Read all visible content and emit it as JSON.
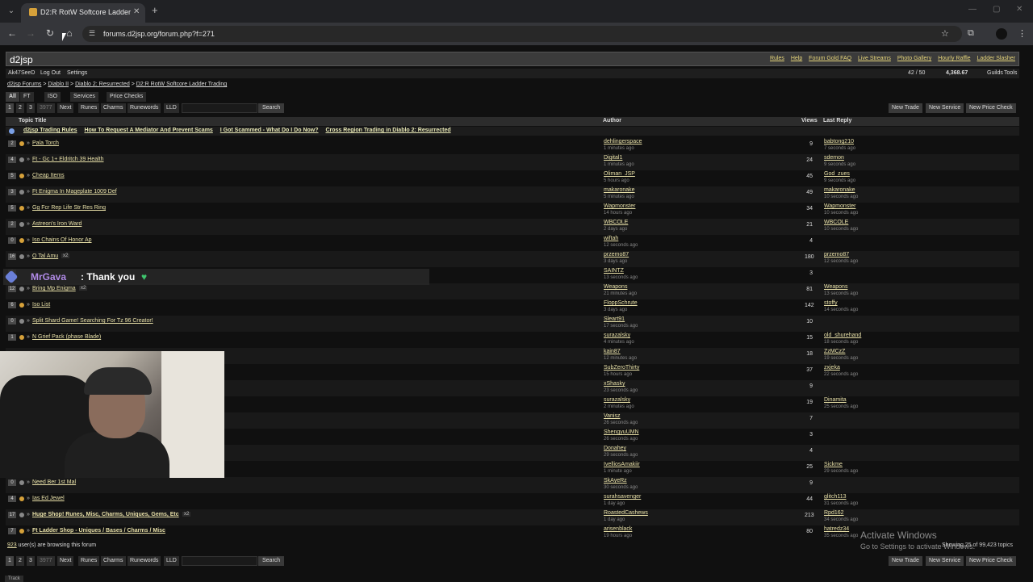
{
  "browser": {
    "tab_title": "D2:R RotW Softcore Ladder Tra",
    "url": "forums.d2jsp.org/forum.php?f=271"
  },
  "site": {
    "brand": "d2jsp",
    "top_links": [
      "Rules",
      "Help",
      "Forum Gold FAQ",
      "Live Streams",
      "Photo Gallery",
      "Hourly Raffle",
      "Ladder Slasher"
    ],
    "user": "Ak47SeeD",
    "logout": "Log Out",
    "settings": "Settings",
    "messages": "42 / 50",
    "gold": "4,368.67",
    "guilds": "Guilds",
    "tools": "Tools"
  },
  "breadcrumbs": [
    "d2jsp Forums",
    "Diablo II",
    "Diablo 2: Resurrected",
    "D2:R RotW Softcore Ladder Trading"
  ],
  "filters": [
    "All",
    "FT",
    "ISO",
    "Services",
    "Price Checks"
  ],
  "pager": {
    "pages": [
      "1",
      "2",
      "3",
      "3977",
      "Next",
      "Runes",
      "Charms",
      "Runewords",
      "LLD"
    ],
    "search": "Search"
  },
  "actions": [
    "New Trade",
    "New Service",
    "New Price Check"
  ],
  "table": {
    "col_title": "Topic Title",
    "col_author": "Author",
    "col_views": "Views",
    "col_lastreply": "Last Reply"
  },
  "pinned": [
    "d2jsp Trading Rules",
    "How To Request A Mediator And Prevent Scams",
    "I Got Scammed - What Do I Do Now?",
    "Cross Region Trading in Diablo 2: Resurrected"
  ],
  "rows": [
    {
      "rep": "2",
      "title": "Pala Torch",
      "pp": "",
      "author": "dehlingerspace",
      "atime": "1 minutes ago",
      "views": "9",
      "lr": "babtong210",
      "ltime": "7 seconds ago"
    },
    {
      "rep": "4",
      "title": "Ft - Gc 1+ Eldritch 39 Health",
      "pp": "",
      "author": "Digital1",
      "atime": "1 minutes ago",
      "views": "24",
      "lr": "sdemon",
      "ltime": "9 seconds ago"
    },
    {
      "rep": "5",
      "title": "Cheap Items",
      "pp": "",
      "author": "Oliman_JSP",
      "atime": "5 hours ago",
      "views": "45",
      "lr": "God_zues",
      "ltime": "9 seconds ago"
    },
    {
      "rep": "3",
      "title": "Ft Enigma In Mageplate 1009 Def",
      "pp": "",
      "author": "makaronake",
      "atime": "5 minutes ago",
      "views": "49",
      "lr": "makaronake",
      "ltime": "10 seconds ago"
    },
    {
      "rep": "5",
      "title": "Gg Fcr Rep Life Str Res Ring",
      "pp": "",
      "author": "Wapmonster",
      "atime": "14 hours ago",
      "views": "34",
      "lr": "Wapmonster",
      "ltime": "10 seconds ago"
    },
    {
      "rep": "2",
      "title": "Astreon's Iron Ward",
      "pp": "",
      "author": "WBCOLE",
      "atime": "2 days ago",
      "views": "21",
      "lr": "WBCOLE",
      "ltime": "10 seconds ago"
    },
    {
      "rep": "0",
      "title": "Iso Chains Of Honor Ap",
      "pp": "",
      "author": "wiftah",
      "atime": "12 seconds ago",
      "views": "4",
      "lr": "",
      "ltime": ""
    },
    {
      "rep": "16",
      "title": "O Tal Amu",
      "pp": "x2",
      "author": "przemo87",
      "atime": "3 days ago",
      "views": "180",
      "lr": "przemo87",
      "ltime": "12 seconds ago"
    },
    {
      "rep": "0",
      "title": "",
      "pp": "",
      "author": "SAINTZ",
      "atime": "13 seconds ago",
      "views": "3",
      "lr": "",
      "ltime": ""
    },
    {
      "rep": "12",
      "title": "Bring Mp Enigma",
      "pp": "x2",
      "author": "Weapons",
      "atime": "21 minutes ago",
      "views": "81",
      "lr": "Weapons",
      "ltime": "13 seconds ago"
    },
    {
      "rep": "6",
      "title": "Iso List",
      "pp": "",
      "author": "FloppSchrute",
      "atime": "3 days ago",
      "views": "142",
      "lr": "stoffy",
      "ltime": "14 seconds ago"
    },
    {
      "rep": "0",
      "title": "Split Shard Game! Searching For Tz 96 Creator!",
      "pp": "",
      "author": "Sleart91",
      "atime": "17 seconds ago",
      "views": "10",
      "lr": "",
      "ltime": ""
    },
    {
      "rep": "1",
      "title": "N Grief Pack (phase Blade)",
      "pp": "",
      "author": "surazalsky",
      "atime": "4 minutes ago",
      "views": "15",
      "lr": "old_shurehand",
      "ltime": "18 seconds ago"
    },
    {
      "rep": "",
      "title": "",
      "pp": "",
      "author": "kain87",
      "atime": "12 minutes ago",
      "views": "18",
      "lr": "ZzMCzZ",
      "ltime": "19 seconds ago"
    },
    {
      "rep": "",
      "title": "",
      "pp": "",
      "author": "SubZeroThirty",
      "atime": "15 hours ago",
      "views": "37",
      "lr": "zxjeka",
      "ltime": "22 seconds ago"
    },
    {
      "rep": "",
      "title": "",
      "pp": "",
      "author": "xShasky",
      "atime": "23 seconds ago",
      "views": "9",
      "lr": "",
      "ltime": ""
    },
    {
      "rep": "",
      "title": "",
      "pp": "",
      "author": "surazalsky",
      "atime": "2 minutes ago",
      "views": "19",
      "lr": "Dinamita",
      "ltime": "25 seconds ago"
    },
    {
      "rep": "",
      "title": "",
      "pp": "",
      "author": "Vanisz",
      "atime": "26 seconds ago",
      "views": "7",
      "lr": "",
      "ltime": ""
    },
    {
      "rep": "",
      "title": "",
      "pp": "",
      "author": "ShengyuUMN",
      "atime": "26 seconds ago",
      "views": "3",
      "lr": "",
      "ltime": ""
    },
    {
      "rep": "",
      "title": "",
      "pp": "",
      "author": "Donahey",
      "atime": "29 seconds ago",
      "views": "4",
      "lr": "",
      "ltime": ""
    },
    {
      "rep": "",
      "title": "",
      "pp": "",
      "author": "IvelliosAmakiir",
      "atime": "1 minute ago",
      "views": "25",
      "lr": "Sickme",
      "ltime": "29 seconds ago"
    },
    {
      "rep": "0",
      "title": "Need Ber 1st Mal",
      "pp": "",
      "author": "SkAyeRz",
      "atime": "30 seconds ago",
      "views": "9",
      "lr": "",
      "ltime": ""
    },
    {
      "rep": "4",
      "title": "Ias Ed Jewel",
      "pp": "",
      "author": "surahsavenger",
      "atime": "1 day ago",
      "views": "44",
      "lr": "glitch113",
      "ltime": "31 seconds ago"
    },
    {
      "rep": "17",
      "title": "Huge Shop! Runes, Misc, Charms, Uniques, Gems, Etc",
      "pp": "x2",
      "author": "RoastedCashews",
      "atime": "1 day ago",
      "views": "213",
      "lr": "Rpd162",
      "ltime": "34 seconds ago"
    },
    {
      "rep": "7",
      "title": "Ft Ladder Shop - Uniques / Bases / Charms / Misc",
      "pp": "",
      "author": "arisenblack",
      "atime": "19 hours ago",
      "views": "80",
      "lr": "hatredz34",
      "ltime": "35 seconds ago"
    }
  ],
  "footer": {
    "online_count": "923",
    "online_text": " user(s) are browsing this forum",
    "showing": "Showing 25 of 99,423 topics"
  },
  "chat": {
    "user": "MrGava",
    "message": ": Thank you"
  },
  "overlay": {
    "activate_title": "Activate Windows",
    "activate_sub": "Go to Settings to activate Windows."
  },
  "track": "Track"
}
